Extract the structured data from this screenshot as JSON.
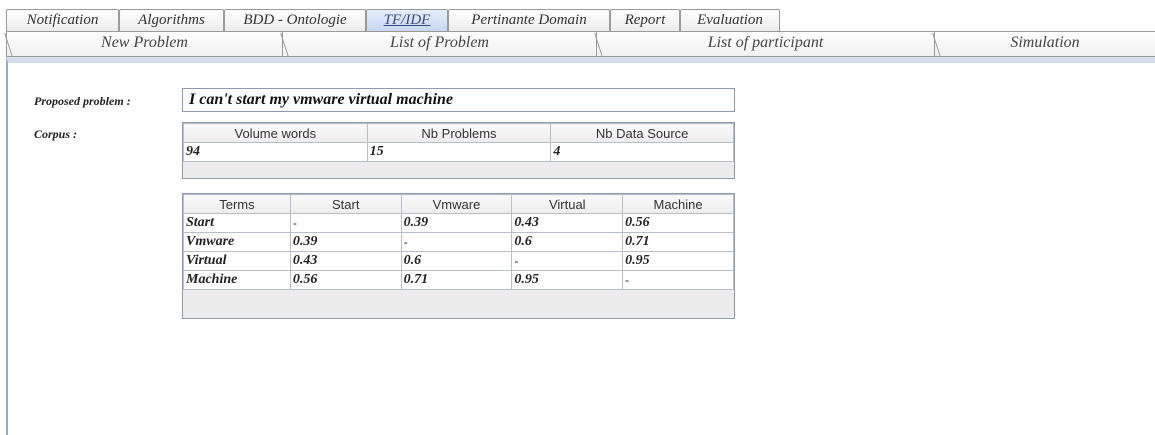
{
  "tabs_row1": [
    "Notification",
    "Algorithms",
    "BDD - Ontologie",
    "TF/IDF",
    "Pertinante Domain",
    "Report",
    "Evaluation"
  ],
  "tabs_row2": [
    "New Problem",
    "List of Problem",
    "List of participant",
    "Simulation"
  ],
  "selected_tab": "TF/IDF",
  "form": {
    "proposed_label": "Proposed problem :",
    "proposed_value": "I can't start my vmware virtual machine",
    "corpus_label": "Corpus :"
  },
  "corpus_table": {
    "headers": [
      "Volume words",
      "Nb Problems",
      "Nb Data Source"
    ],
    "values": [
      "94",
      "15",
      "4"
    ]
  },
  "terms_table": {
    "headers": [
      "Terms",
      "Start",
      "Vmware",
      "Virtual",
      "Machine"
    ],
    "rows": [
      [
        "Start",
        "-",
        "0.39",
        "0.43",
        "0.56"
      ],
      [
        "Vmware",
        "0.39",
        "-",
        "0.6",
        "0.71"
      ],
      [
        "Virtual",
        "0.43",
        "0.6",
        "-",
        "0.95"
      ],
      [
        "Machine",
        "0.56",
        "0.71",
        "0.95",
        "-"
      ]
    ]
  }
}
